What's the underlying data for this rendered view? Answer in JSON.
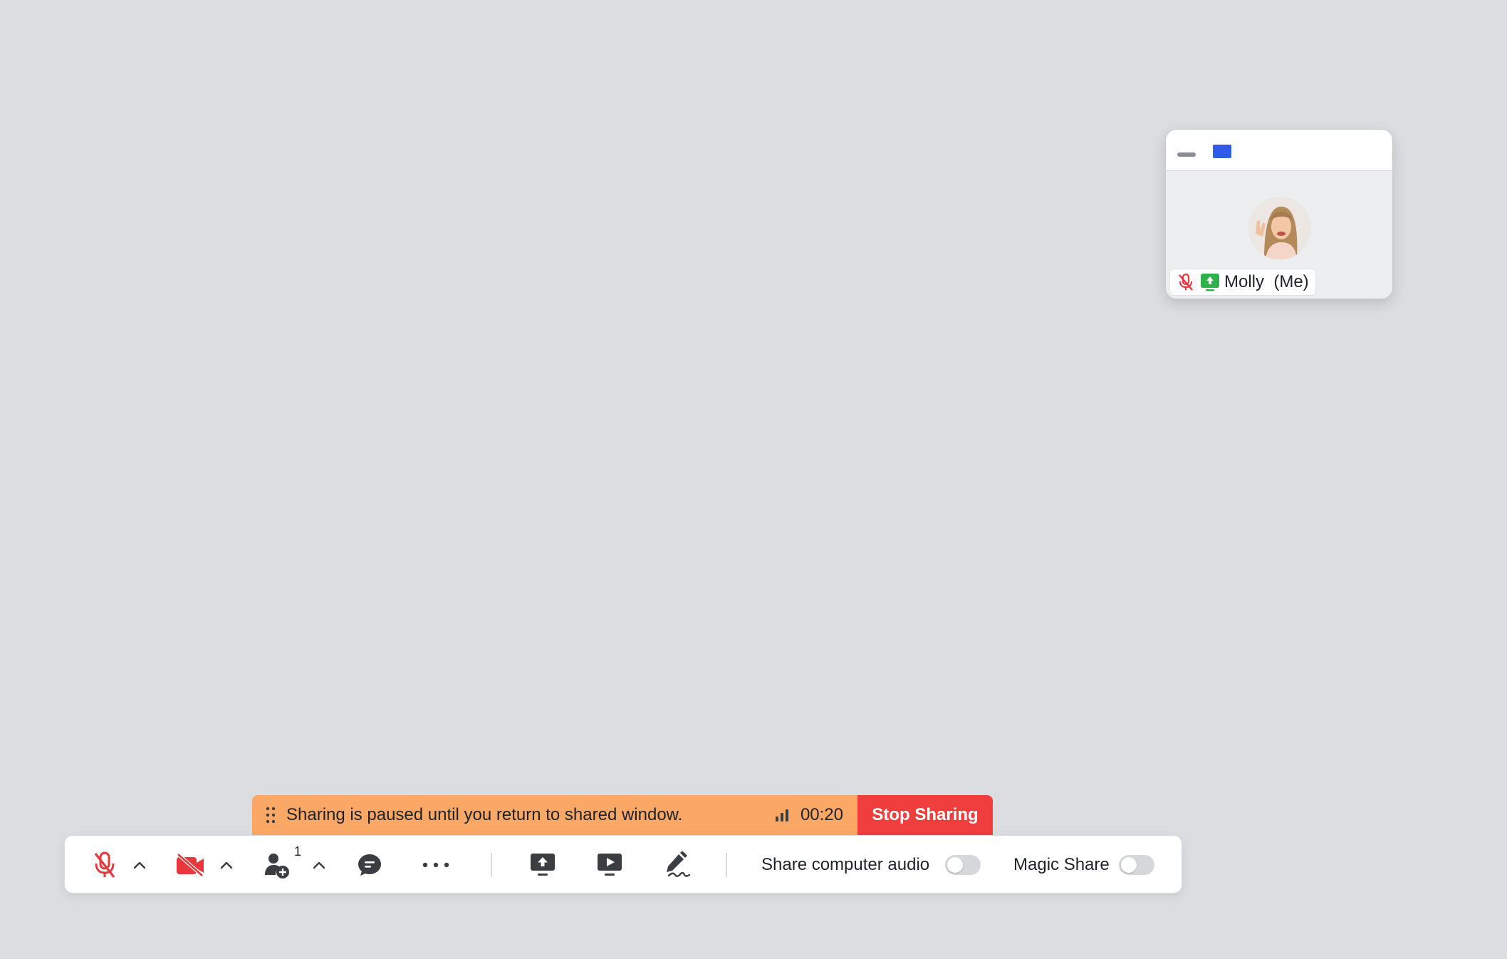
{
  "participant_window": {
    "name": "Molly",
    "suffix": "(Me)",
    "name_display": "Molly  (Me)"
  },
  "share_banner": {
    "message": "Sharing is paused until you return to shared window.",
    "timer": "00:20",
    "stop_label": "Stop Sharing"
  },
  "toolbar": {
    "participant_count": "1",
    "share_audio_label": "Share computer audio",
    "magic_share_label": "Magic Share"
  },
  "colors": {
    "banner": "#fba866",
    "stop": "#f03d3e",
    "muted_red": "#e8383d",
    "share_green": "#2fb14a",
    "layout_blue": "#2f5be8"
  }
}
